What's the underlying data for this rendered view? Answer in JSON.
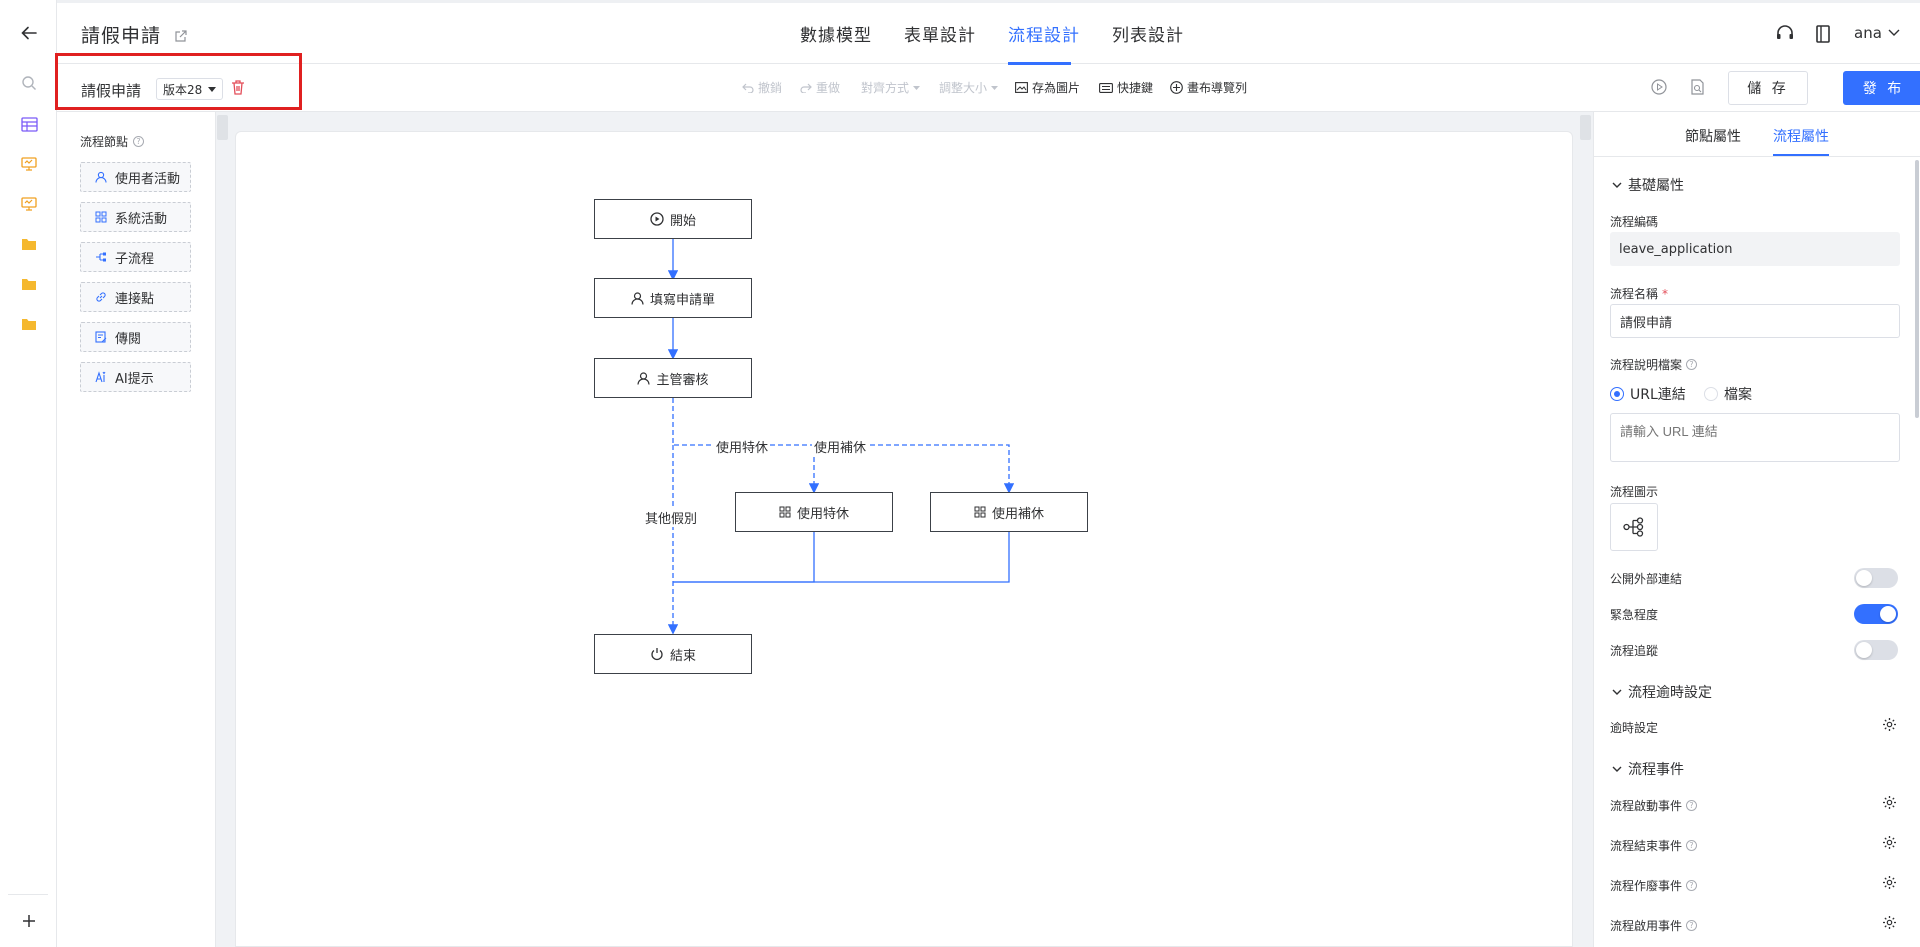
{
  "app": {
    "title": "請假申請"
  },
  "tabs": [
    {
      "label": "數據模型"
    },
    {
      "label": "表單設計"
    },
    {
      "label": "流程設計"
    },
    {
      "label": "列表設計"
    }
  ],
  "header": {
    "user": "ana"
  },
  "toolbar": {
    "process_name": "請假申請",
    "version": "版本28",
    "undo": "撤銷",
    "redo": "重做",
    "align": "對齊方式",
    "resize": "調整大小",
    "save_image": "存為圖片",
    "shortcuts": "快捷鍵",
    "canvas_nav": "畫布導覽列",
    "save": "儲 存",
    "publish": "發 布"
  },
  "nodes_panel": {
    "title": "流程節點",
    "items": [
      {
        "label": "使用者活動",
        "icon": "user-icon"
      },
      {
        "label": "系統活動",
        "icon": "grid-icon"
      },
      {
        "label": "子流程",
        "icon": "subprocess-icon"
      },
      {
        "label": "連接點",
        "icon": "link-icon"
      },
      {
        "label": "傳閱",
        "icon": "circulate-icon"
      },
      {
        "label": "AI提示",
        "icon": "ai-icon"
      }
    ]
  },
  "flow": {
    "nodes": {
      "start": "開始",
      "fill": "填寫申請單",
      "review": "主管審核",
      "special": "使用特休",
      "comp": "使用補休",
      "end": "結束"
    },
    "edges": {
      "special": "使用特休",
      "comp": "使用補休",
      "other": "其他假別"
    }
  },
  "props": {
    "tabs": {
      "node": "節點屬性",
      "process": "流程屬性"
    },
    "basic": {
      "title": "基礎屬性",
      "code_label": "流程編碼",
      "code_value": "leave_application",
      "name_label": "流程名稱",
      "name_value": "請假申請",
      "doc_label": "流程說明檔案",
      "radio_url": "URL連結",
      "radio_file": "檔案",
      "url_placeholder": "請輸入 URL 連結",
      "icon_label": "流程圖示",
      "public_link": "公開外部連結",
      "public_link_on": false,
      "urgency": "緊急程度",
      "urgency_on": true,
      "tracking": "流程追蹤",
      "tracking_on": false
    },
    "timeout": {
      "title": "流程逾時設定",
      "setting": "逾時設定"
    },
    "events": {
      "title": "流程事件",
      "start": "流程啟動事件",
      "end": "流程結束事件",
      "void": "流程作廢事件",
      "enable": "流程啟用事件"
    }
  },
  "colors": {
    "accent": "#3370ff",
    "danger": "#e34d59",
    "highlight_box": "#e02020"
  }
}
